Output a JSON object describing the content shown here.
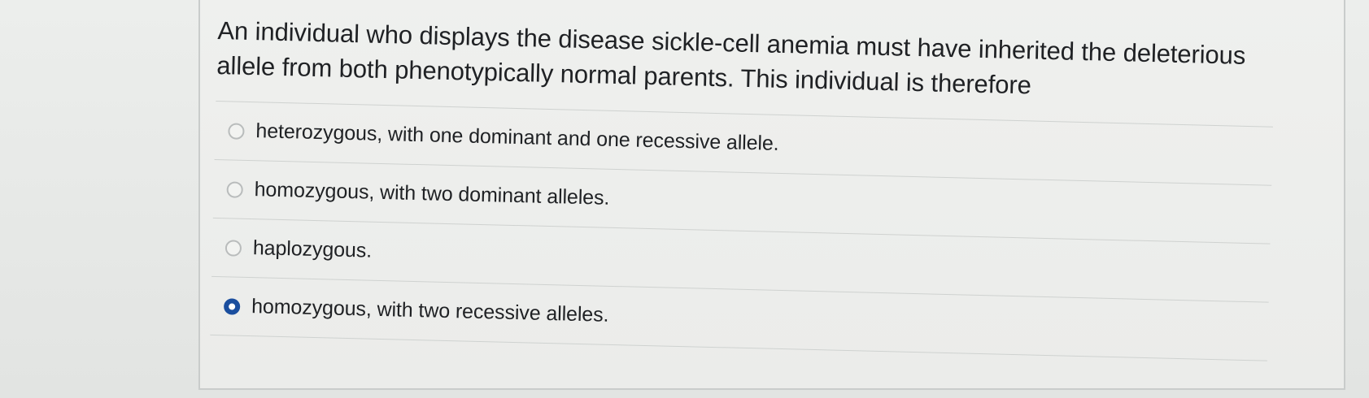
{
  "question": {
    "text": "An individual who displays the disease sickle-cell anemia must have inherited the deleterious allele from both phenotypically normal parents. This individual is therefore"
  },
  "answers": [
    {
      "label": "heterozygous, with one dominant and one recessive allele.",
      "selected": false
    },
    {
      "label": "homozygous, with two dominant alleles.",
      "selected": false
    },
    {
      "label": "haplozygous.",
      "selected": false
    },
    {
      "label": "homozygous, with two recessive alleles.",
      "selected": true
    }
  ],
  "colors": {
    "selected_radio": "#1a4e9e",
    "text": "#1f2124"
  }
}
